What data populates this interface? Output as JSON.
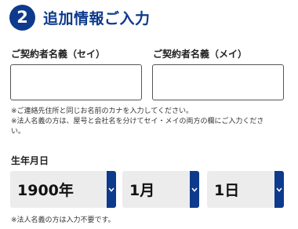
{
  "colors": {
    "accent": "#0d3a8c",
    "select_bg": "#ececec",
    "input_border": "#555555"
  },
  "section": {
    "step_number": "2",
    "title": "追加情報ご入力"
  },
  "fields": {
    "name_kana_sei": {
      "label": "ご契約者名義（セイ）",
      "value": ""
    },
    "name_kana_mei": {
      "label": "ご契約者名義（メイ）",
      "value": ""
    }
  },
  "notes": [
    "※ご連絡先住所と同じお名前のカナを入力してください。",
    "※法人名義の方は、屋号と会社名を分けてセイ・メイの両方の欄にご入力くださ",
    "い。"
  ],
  "birthdate": {
    "label": "生年月日",
    "year": "1900年",
    "month": "1月",
    "day": "1日",
    "note": "※法人名義の方は入力不要です。",
    "arrow_icon": "chevron-down-icon"
  }
}
